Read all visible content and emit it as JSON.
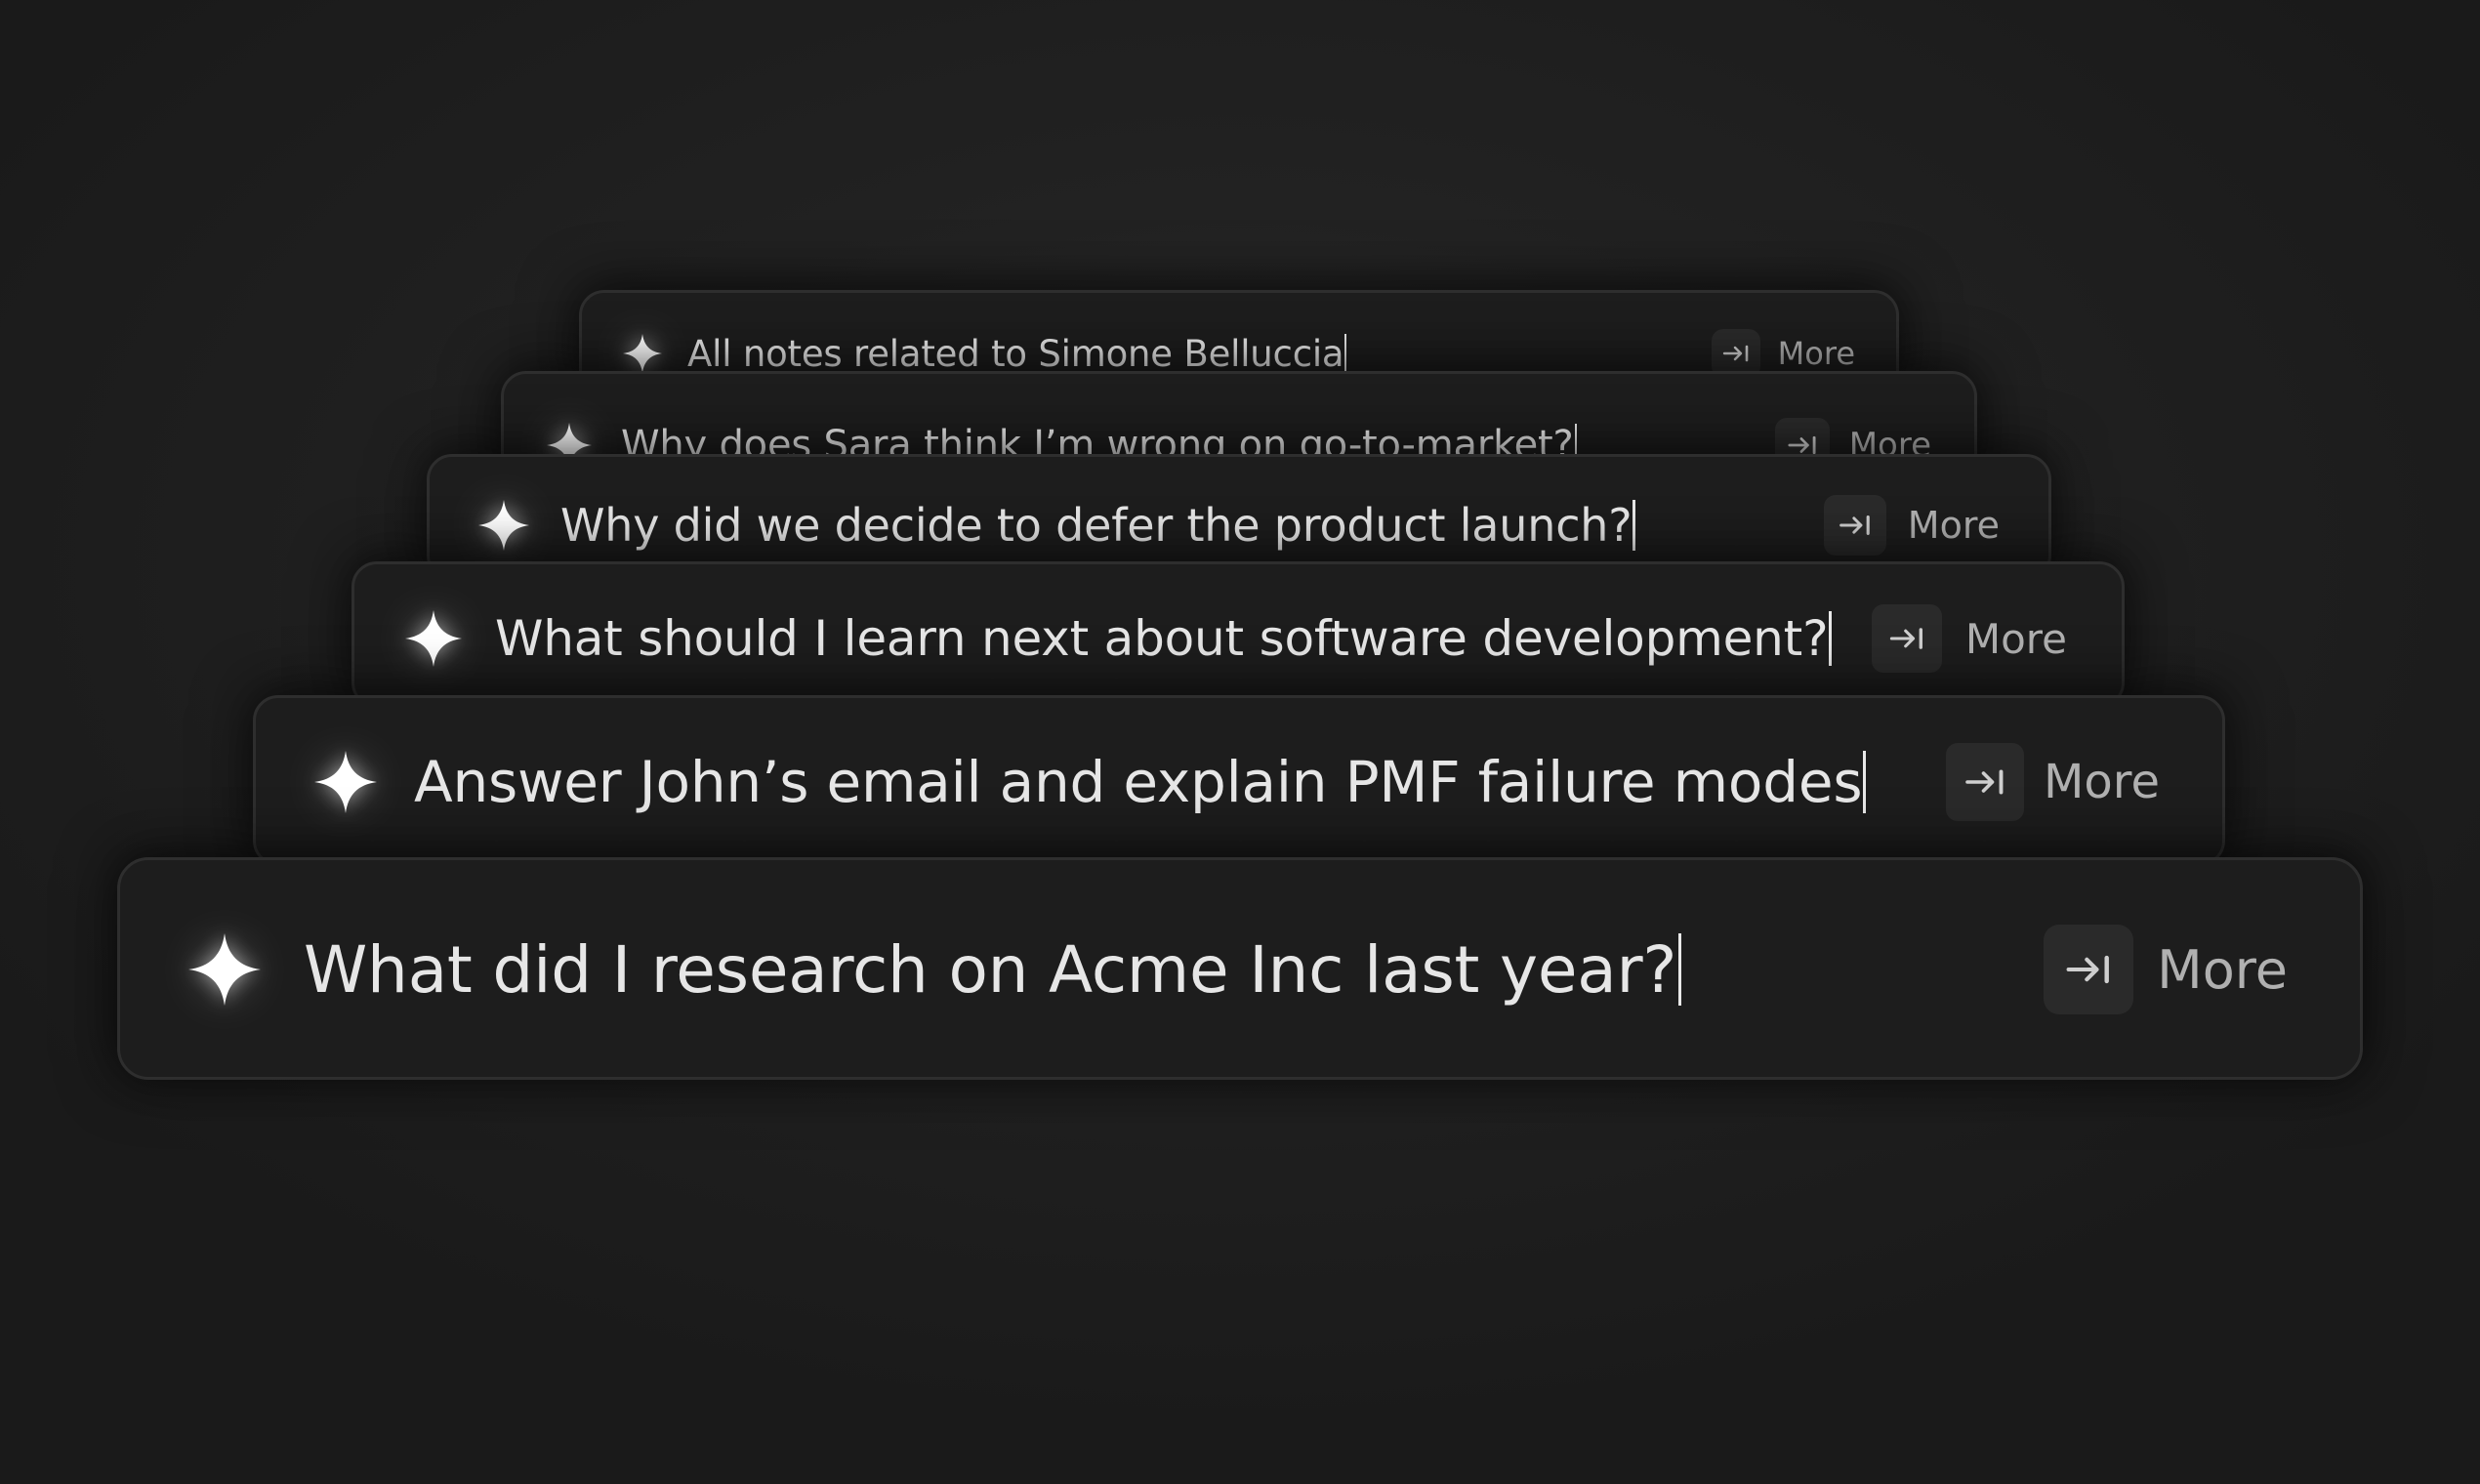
{
  "cards": [
    {
      "query": "All notes related to Simone Belluccia",
      "more_label": "More",
      "icon": "sparkle-icon",
      "key_icon": "tab-key-icon"
    },
    {
      "query": "Why does Sara think I’m wrong on go-to-market?",
      "more_label": "More",
      "icon": "sparkle-icon",
      "key_icon": "tab-key-icon"
    },
    {
      "query": "Why did we decide to defer the product launch?",
      "more_label": "More",
      "icon": "sparkle-icon",
      "key_icon": "tab-key-icon"
    },
    {
      "query": "What should I learn next about software development?",
      "more_label": "More",
      "icon": "sparkle-icon",
      "key_icon": "tab-key-icon"
    },
    {
      "query": "Answer John’s email and explain PMF failure modes",
      "more_label": "More",
      "icon": "sparkle-icon",
      "key_icon": "tab-key-icon"
    },
    {
      "query": "What did I research on Acme Inc last year?",
      "more_label": "More",
      "icon": "sparkle-icon",
      "key_icon": "tab-key-icon"
    }
  ],
  "colors": {
    "background": "#1f1f1f",
    "card": "#1d1d1d",
    "card_border": "#2e2e2e",
    "text": "#e6e6e6",
    "muted": "#b0b0b0",
    "key_bg": "#2a2a2a"
  }
}
